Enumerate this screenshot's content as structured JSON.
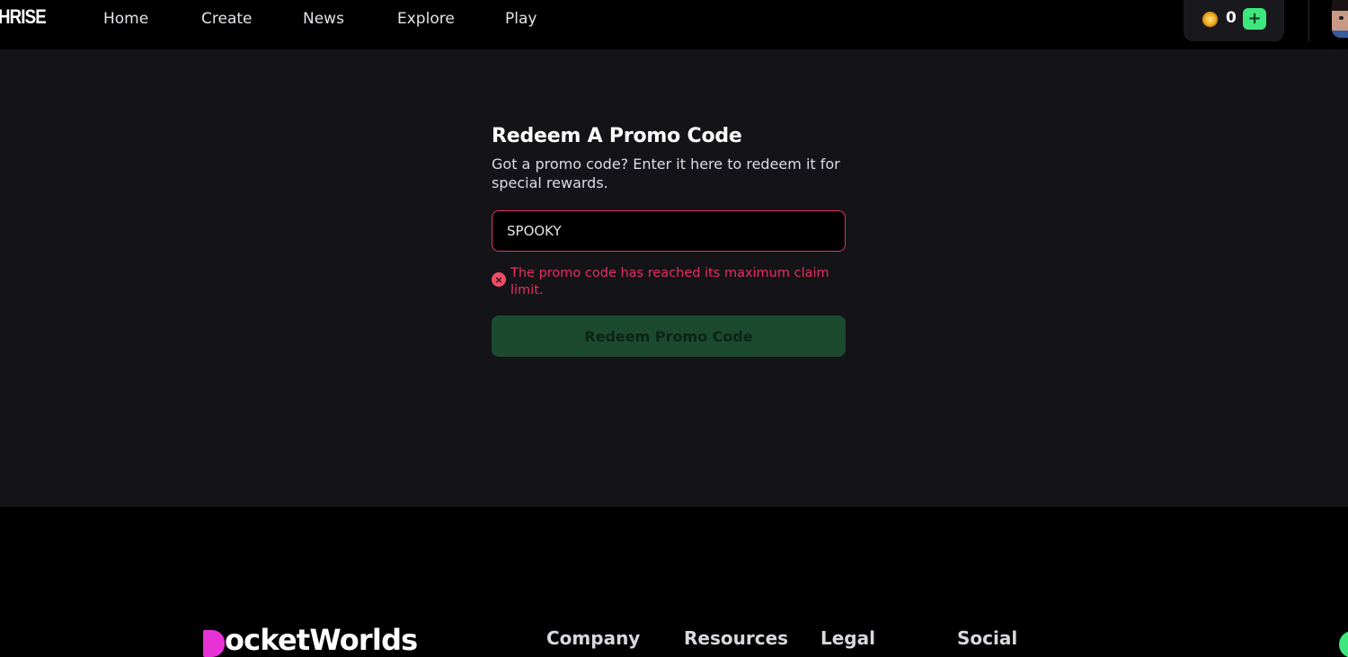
{
  "header": {
    "logo": "HRISE",
    "nav": [
      "Home",
      "Create",
      "News",
      "Explore",
      "Play"
    ],
    "wallet": {
      "coins": "0",
      "add_label": "+"
    }
  },
  "promo": {
    "title": "Redeem A Promo Code",
    "subtitle": "Got a promo code? Enter it here to redeem it for special rewards.",
    "input_value": "SPOOKY",
    "error_icon": "×",
    "error": "The promo code has reached its maximum claim limit.",
    "button_label": "Redeem Promo Code"
  },
  "footer": {
    "logo": "ocketWorlds",
    "columns": [
      "Company",
      "Resources",
      "Legal",
      "Social"
    ]
  },
  "colors": {
    "accent_green": "#3de77e",
    "error": "#e6315f",
    "page_bg": "#141318"
  }
}
